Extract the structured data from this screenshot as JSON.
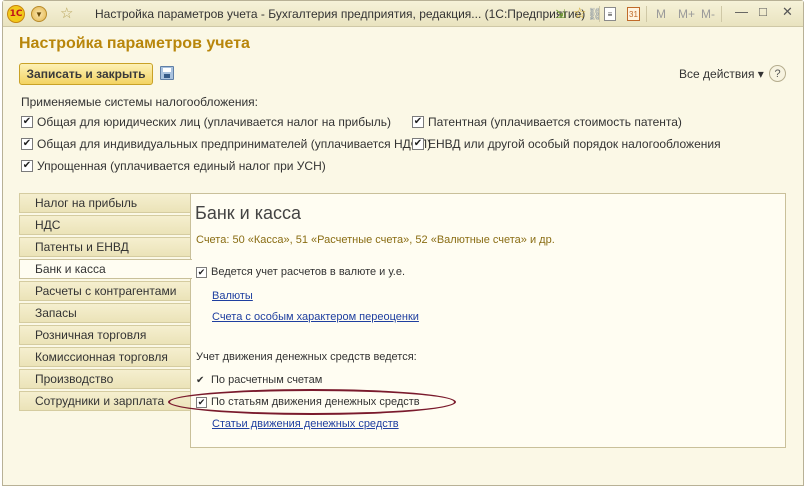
{
  "window": {
    "logo": "1С",
    "title": "Настройка параметров учета - Бухгалтерия предприятия, редакция... (1С:Предприятие)",
    "title_display": "Настройка параметров учета - Бухгалтерия предприятия, редакция...  (1С:Предприятие)",
    "toolbar_m": "M",
    "toolbar_mplus": "M+",
    "toolbar_mminus": "M-",
    "minimize": "—",
    "restore": "□",
    "close": "✕"
  },
  "form": {
    "heading": "Настройка параметров учета",
    "save_close_label": "Записать и закрыть",
    "all_actions_label": "Все действия ▾",
    "help_label": "?"
  },
  "taxation": {
    "label": "Применяемые системы налогообложения:",
    "options": [
      {
        "label": "Общая для юридических лиц (уплачивается налог на прибыль)",
        "checked": true
      },
      {
        "label": "Общая для индивидуальных предпринимателей (уплачивается НДФЛ)",
        "checked": true
      },
      {
        "label": "Упрощенная (уплачивается единый налог при УСН)",
        "checked": true
      },
      {
        "label": "Патентная (уплачивается стоимость патента)",
        "checked": true
      },
      {
        "label": "ЕНВД или другой особый порядок налогообложения",
        "checked": true
      }
    ]
  },
  "nav": {
    "items": [
      {
        "label": "Налог на прибыль"
      },
      {
        "label": "НДС"
      },
      {
        "label": "Патенты и ЕНВД"
      },
      {
        "label": "Банк и касса",
        "active": true
      },
      {
        "label": "Расчеты с контрагентами"
      },
      {
        "label": "Запасы"
      },
      {
        "label": "Розничная торговля"
      },
      {
        "label": "Комиссионная торговля"
      },
      {
        "label": "Производство"
      },
      {
        "label": "Сотрудники и зарплата"
      }
    ]
  },
  "panel": {
    "title": "Банк и касса",
    "accounts_text": "Счета: 50 «Касса», 51 «Расчетные счета», 52 «Валютные счета» и др.",
    "currency_check_label": "Ведется учет расчетов в валюте и у.е.",
    "currency_checked": true,
    "link_currencies": "Валюты",
    "link_special_revaluation": "Счета с особым характером переоценки",
    "movement_label": "Учет движения денежных средств ведется:",
    "by_accounts_label": "По расчетным счетам",
    "by_accounts_checked": true,
    "by_cashflow_items_label": "По статьям движения денежных средств",
    "by_cashflow_items_checked": true,
    "link_cashflow_items": "Статьи движения денежных средств"
  },
  "colors": {
    "heading": "#b8860b",
    "link": "#1f3fa0",
    "highlight_oval": "#7a1a2c"
  }
}
